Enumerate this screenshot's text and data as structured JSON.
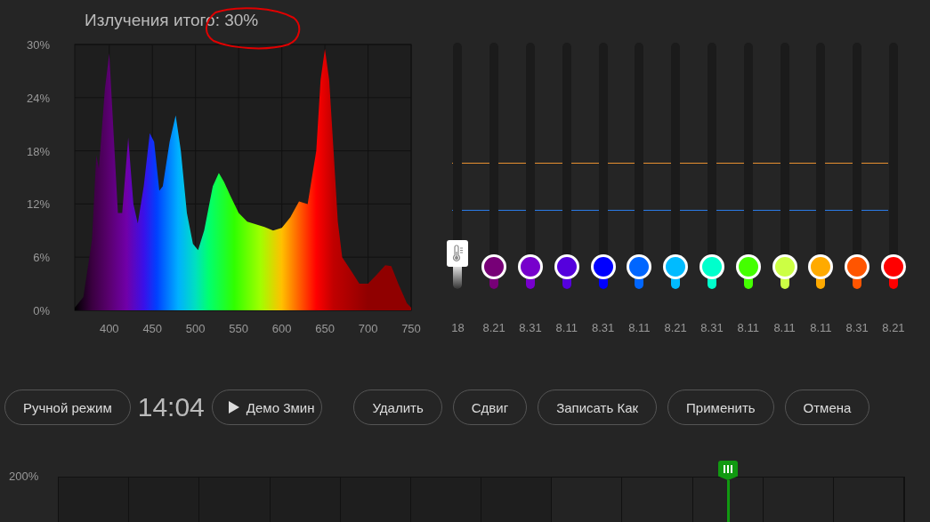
{
  "title": "Излучения итого: 30%",
  "spectrum": {
    "chart_data": {
      "type": "area",
      "x": [
        360,
        370,
        380,
        385,
        388,
        395,
        400,
        405,
        410,
        415,
        422,
        428,
        433,
        440,
        447,
        452,
        458,
        462,
        470,
        477,
        483,
        490,
        497,
        503,
        510,
        520,
        527,
        533,
        540,
        550,
        560,
        570,
        580,
        590,
        600,
        610,
        620,
        630,
        640,
        645,
        650,
        655,
        660,
        665,
        670,
        680,
        690,
        700,
        710,
        720,
        727,
        735,
        745,
        750
      ],
      "grid": true,
      "series": [
        {
          "values": [
            0.3,
            1.5,
            8,
            17.5,
            16,
            25,
            29,
            20,
            11,
            11,
            19.5,
            12,
            9.8,
            14,
            20,
            19,
            13.5,
            14,
            19,
            22,
            18,
            11,
            7.5,
            6.8,
            9,
            14,
            15.5,
            14.5,
            13,
            11,
            10,
            9.7,
            9.4,
            9,
            9.3,
            10.5,
            12.3,
            12,
            18,
            26,
            29.5,
            26,
            18,
            10,
            6,
            4.5,
            3,
            3,
            4,
            5.1,
            5,
            3,
            0.8,
            0.3
          ]
        }
      ],
      "xlim": [
        360,
        750
      ],
      "ylim": [
        0,
        30
      ],
      "xticks": [
        400,
        450,
        500,
        550,
        600,
        650,
        700,
        750
      ],
      "yticks": [
        {
          "value": 0,
          "label": "0%"
        },
        {
          "value": 6,
          "label": "6%"
        },
        {
          "value": 12,
          "label": "12%"
        },
        {
          "value": 18,
          "label": "18%"
        },
        {
          "value": 24,
          "label": "24%"
        },
        {
          "value": 30,
          "label": "30%"
        }
      ]
    }
  },
  "channels": [
    {
      "kind": "temperature",
      "level": 0.09,
      "reading": "18"
    },
    {
      "kind": "color",
      "color": "#770077",
      "level": 0.09,
      "reading": "8.21"
    },
    {
      "kind": "color",
      "color": "#7700cc",
      "level": 0.09,
      "reading": "8.31"
    },
    {
      "kind": "color",
      "color": "#5500dd",
      "level": 0.09,
      "reading": "8.11"
    },
    {
      "kind": "color",
      "color": "#0000ff",
      "level": 0.09,
      "reading": "8.31"
    },
    {
      "kind": "color",
      "color": "#0066ff",
      "level": 0.09,
      "reading": "8.11"
    },
    {
      "kind": "color",
      "color": "#00bbff",
      "level": 0.09,
      "reading": "8.21"
    },
    {
      "kind": "color",
      "color": "#00ffcc",
      "level": 0.09,
      "reading": "8.31"
    },
    {
      "kind": "color",
      "color": "#44ff00",
      "level": 0.09,
      "reading": "8.11"
    },
    {
      "kind": "color",
      "color": "#ccff44",
      "level": 0.09,
      "reading": "8.11"
    },
    {
      "kind": "color",
      "color": "#ffaa00",
      "level": 0.09,
      "reading": "8.11"
    },
    {
      "kind": "color",
      "color": "#ff5500",
      "level": 0.09,
      "reading": "8.31"
    },
    {
      "kind": "color",
      "color": "#ff0000",
      "level": 0.09,
      "reading": "8.21"
    }
  ],
  "mode_button": "Ручной режим",
  "clock": "14:04",
  "demo_button": "Демо 3мин",
  "buttons": [
    "Удалить",
    "Сдвиг",
    "Записать Как",
    "Применить",
    "Отмена"
  ],
  "timeline": {
    "y_label": "200%"
  }
}
